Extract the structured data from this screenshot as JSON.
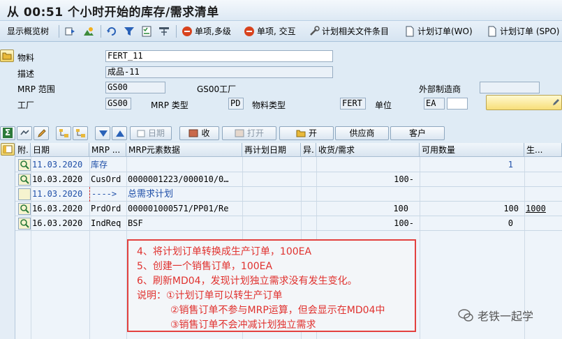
{
  "title": "从 00:51 个小时开始的库存/需求清单",
  "toolbar": {
    "items": [
      {
        "label": "显示概览树",
        "icon": ""
      },
      {
        "label": "",
        "icon": "double-arrow-icon"
      },
      {
        "label": "",
        "icon": "landscape-icon"
      },
      {
        "label": "",
        "icon": "refresh-icon"
      },
      {
        "label": "",
        "icon": "filter-icon"
      },
      {
        "label": "",
        "icon": "checklist-icon"
      },
      {
        "label": "",
        "icon": "tree-icon"
      },
      {
        "label": "单项,多级",
        "icon": "stop-icon"
      },
      {
        "label": "单项, 交互",
        "icon": "stop-icon"
      },
      {
        "label": "计划相关文件条目",
        "icon": "tools-icon"
      },
      {
        "label": "计划订单(WO)",
        "icon": "document-icon"
      },
      {
        "label": "计划订单 (SPO)",
        "icon": "document-icon"
      }
    ]
  },
  "header": {
    "material_label": "物料",
    "material_value": "FERT_11",
    "desc_label": "描述",
    "desc_value": "成品-11",
    "mrp_area_label": "MRP 范围",
    "mrp_area_value": "GS00",
    "mrp_area_desc": "GS00工厂",
    "ext_mfr_label": "外部制造商",
    "ext_mfr_value": "",
    "plant_label": "工厂",
    "plant_value": "GS00",
    "mrp_type_label": "MRP 类型",
    "mrp_type_value": "PD",
    "mat_type_label": "物料类型",
    "mat_type_value": "FERT",
    "unit_label": "单位",
    "unit_value": "EA",
    "unit_extra": ""
  },
  "buttons": {
    "date": "日期",
    "receive": "收",
    "open": "打开",
    "open2": "开",
    "vendor": "供应商",
    "customer": "客户"
  },
  "grid": {
    "headers": [
      "附.",
      "日期",
      "MRP ...",
      "MRP元素数据",
      "再计划日期",
      "异.",
      "收货/需求",
      "可用数量",
      "生..."
    ],
    "rows": [
      {
        "date": "11.03.2020",
        "mrp": "库存",
        "data": "",
        "replan": "",
        "exc": "",
        "rec": "",
        "avail": "1",
        "extra": "",
        "style": "blue"
      },
      {
        "date": "10.03.2020",
        "mrp": "CusOrd",
        "data": "0000001223/000010/0…",
        "replan": "",
        "exc": "",
        "rec": "100-",
        "avail": "",
        "extra": "",
        "style": ""
      },
      {
        "date": "11.03.2020",
        "mrp": "---->",
        "data": "总需求计划",
        "replan": "",
        "exc": "",
        "rec": "",
        "avail": "",
        "extra": "",
        "style": "blue"
      },
      {
        "date": "16.03.2020",
        "mrp": "PrdOrd",
        "data": "000001000571/PP01/Re",
        "replan": "",
        "exc": "",
        "rec": "100",
        "avail": "100",
        "extra": "1000",
        "style": ""
      },
      {
        "date": "16.03.2020",
        "mrp": "IndReq",
        "data": "BSF",
        "replan": "",
        "exc": "",
        "rec": "100-",
        "avail": "0",
        "extra": "",
        "style": ""
      }
    ]
  },
  "note": {
    "lines": [
      "4、将计划订单转换成生产订单，100EA",
      "5、创建一个销售订单，100EA",
      "6、刷新MD04，发现计划独立需求没有发生变化。",
      "说明：①计划订单可以转生产订单",
      "②销售订单不参与MRP运算，但会显示在MD04中",
      "③销售订单不会冲减计划独立需求"
    ]
  },
  "watermark": "老铁一起学",
  "colors": {
    "accent": "#1f4fa8",
    "note_red": "#e0312e",
    "background": "#dfebf5"
  }
}
